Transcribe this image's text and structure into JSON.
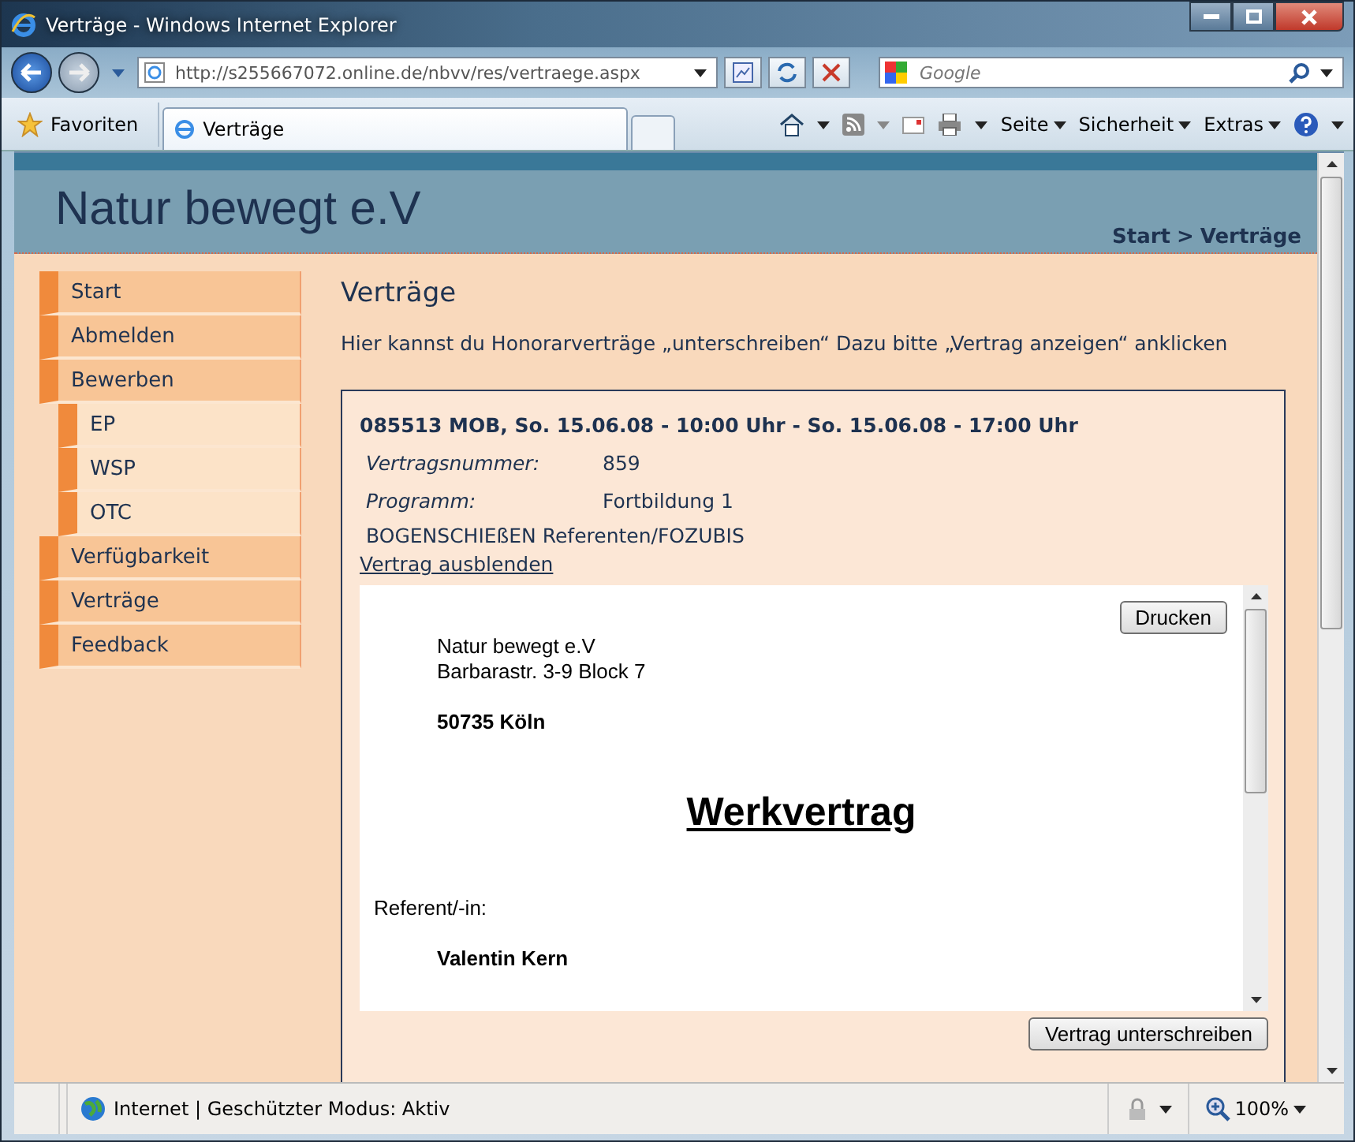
{
  "window": {
    "title": "Verträge - Windows Internet Explorer"
  },
  "address_bar": {
    "url": "http://s255667072.online.de/nbvv/res/vertraege.aspx"
  },
  "search": {
    "placeholder": "Google"
  },
  "favorites": {
    "label": "Favoriten"
  },
  "tabs": [
    {
      "label": "Verträge",
      "selected": true
    }
  ],
  "command_bar": [
    "Seite",
    "Sicherheit",
    "Extras"
  ],
  "page": {
    "site_title": "Natur bewegt e.V",
    "breadcrumb": {
      "items": [
        "Start",
        "Verträge"
      ],
      "separator": ">"
    },
    "menu": [
      {
        "label": "Start"
      },
      {
        "label": "Abmelden"
      },
      {
        "label": "Bewerben",
        "children": [
          {
            "label": "EP"
          },
          {
            "label": "WSP"
          },
          {
            "label": "OTC"
          }
        ]
      },
      {
        "label": "Verfügbarkeit"
      },
      {
        "label": "Verträge"
      },
      {
        "label": "Feedback"
      }
    ],
    "heading": "Verträge",
    "intro": "Hier kannst du Honorarverträge „unterschreiben“ Dazu bitte „Vertrag anzeigen“ anklicken",
    "contract": {
      "title": "085513 MOB,  So. 15.06.08 - 10:00 Uhr -  So. 15.06.08 - 17:00 Uhr",
      "fields": [
        {
          "label": "Vertragsnummer:",
          "value": "859"
        },
        {
          "label": "Programm:",
          "value": "Fortbildung 1"
        }
      ],
      "description": "BOGENSCHIEßEN Referenten/FOZUBIS",
      "toggle_link": "Vertrag ausblenden",
      "document": {
        "print_button": "Drucken",
        "address_lines": [
          "Natur bewegt e.V",
          "Barbarastr. 3-9 Block 7"
        ],
        "city": "50735 Köln",
        "doc_title": "Werkvertrag",
        "party_label": "Referent/-in:",
        "party_name": "Valentin Kern"
      },
      "sign_button": "Vertrag unterschreiben"
    }
  },
  "status_bar": {
    "zone": "Internet | Geschützter Modus: Aktiv",
    "zoom": "100%"
  }
}
